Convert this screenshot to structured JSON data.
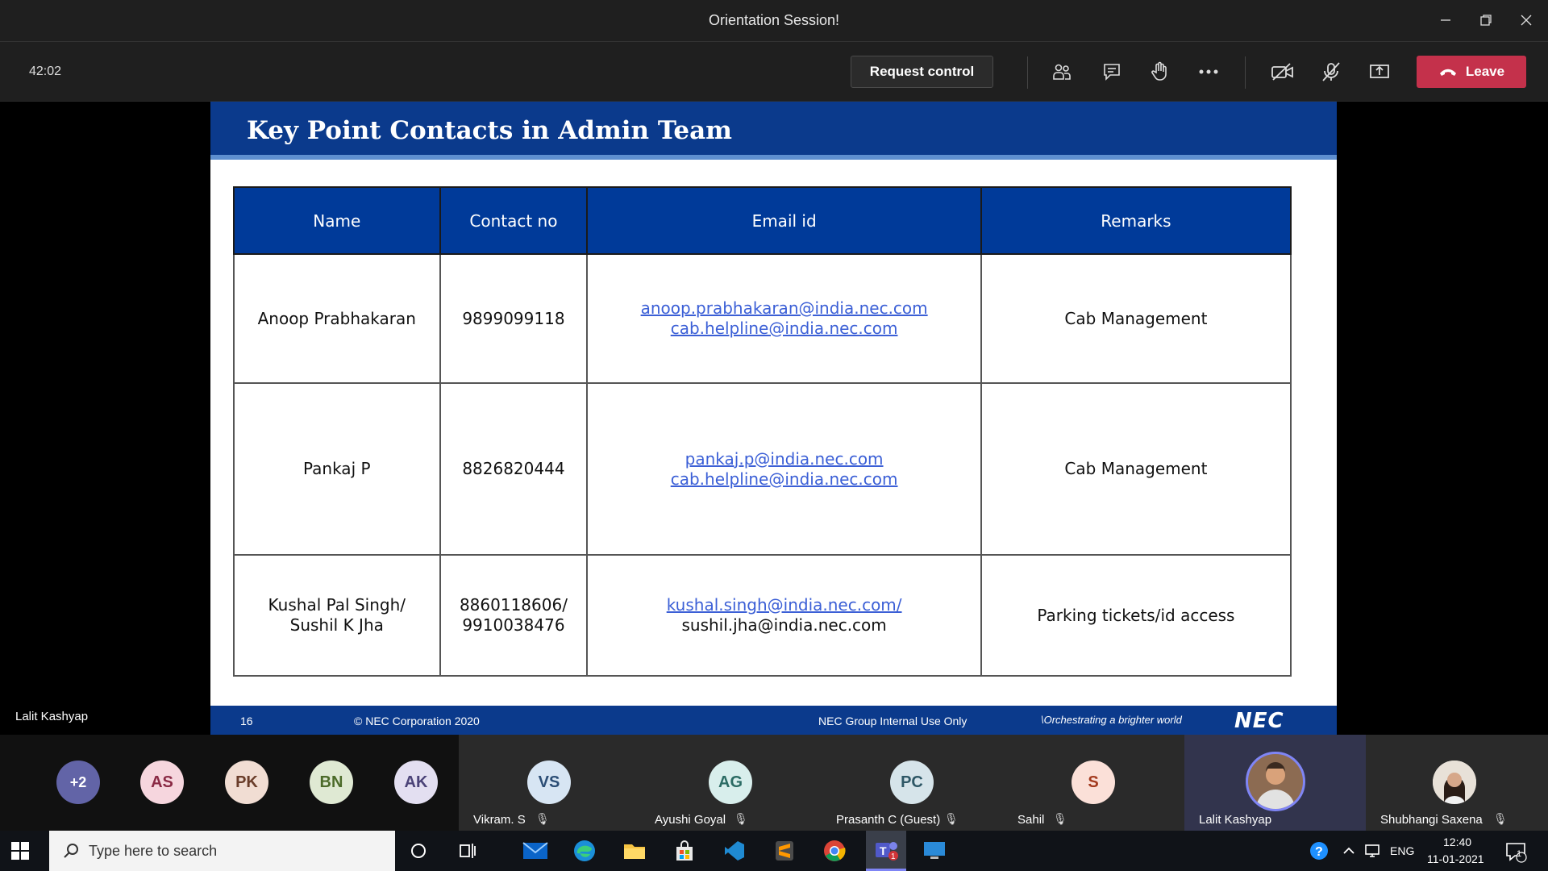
{
  "window": {
    "title": "Orientation Session!"
  },
  "toolbar": {
    "timer": "42:02",
    "request_control": "Request control",
    "leave": "Leave"
  },
  "slide": {
    "title": "Key Point Contacts in Admin Team",
    "headers": [
      "Name",
      "Contact no",
      "Email id",
      "Remarks"
    ],
    "rows": [
      {
        "name": [
          "Anoop Prabhakaran"
        ],
        "contact": [
          "9899099118"
        ],
        "emails": [
          "anoop.prabhakaran@india.nec.com",
          "cab.helpline@india.nec.com"
        ],
        "remarks": "Cab Management"
      },
      {
        "name": [
          "Pankaj P"
        ],
        "contact": [
          "8826820444"
        ],
        "emails": [
          "pankaj.p@india.nec.com",
          "cab.helpline@india.nec.com"
        ],
        "remarks": "Cab Management"
      },
      {
        "name": [
          "Kushal Pal Singh/",
          "Sushil K Jha"
        ],
        "contact": [
          "8860118606/",
          "9910038476"
        ],
        "emails": [
          "kushal.singh@india.nec.com/",
          "sushil.jha@india.nec.com"
        ],
        "remarks": "Parking tickets/id access"
      }
    ],
    "footer": {
      "page": "16",
      "copyright": "© NEC Corporation 2020",
      "classification": "NEC Group Internal Use Only",
      "tagline": "\\Orchestrating a brighter world",
      "logo": "NEC"
    }
  },
  "presenter": "Lalit Kashyap",
  "participants": {
    "overflow": "+2",
    "bubbles": [
      "AS",
      "PK",
      "BN",
      "AK"
    ],
    "tiles": [
      {
        "initials": "VS",
        "name": "Vikram. S"
      },
      {
        "initials": "AG",
        "name": "Ayushi Goyal"
      },
      {
        "initials": "PC",
        "name": "Prasanth C (Guest)"
      },
      {
        "initials": "S",
        "name": "Sahil"
      },
      {
        "initials": "",
        "name": "Lalit Kashyap"
      },
      {
        "initials": "",
        "name": "Shubhangi Saxena"
      }
    ]
  },
  "taskbar": {
    "search_placeholder": "Type here to search",
    "language": "ENG",
    "time": "12:40",
    "date": "11-01-2021",
    "notification_count": "1"
  },
  "colors": {
    "slide_blue": "#0b3a8c",
    "table_header": "#003a99",
    "leave_red": "#c4314b",
    "link_blue": "#3b5fd6"
  }
}
